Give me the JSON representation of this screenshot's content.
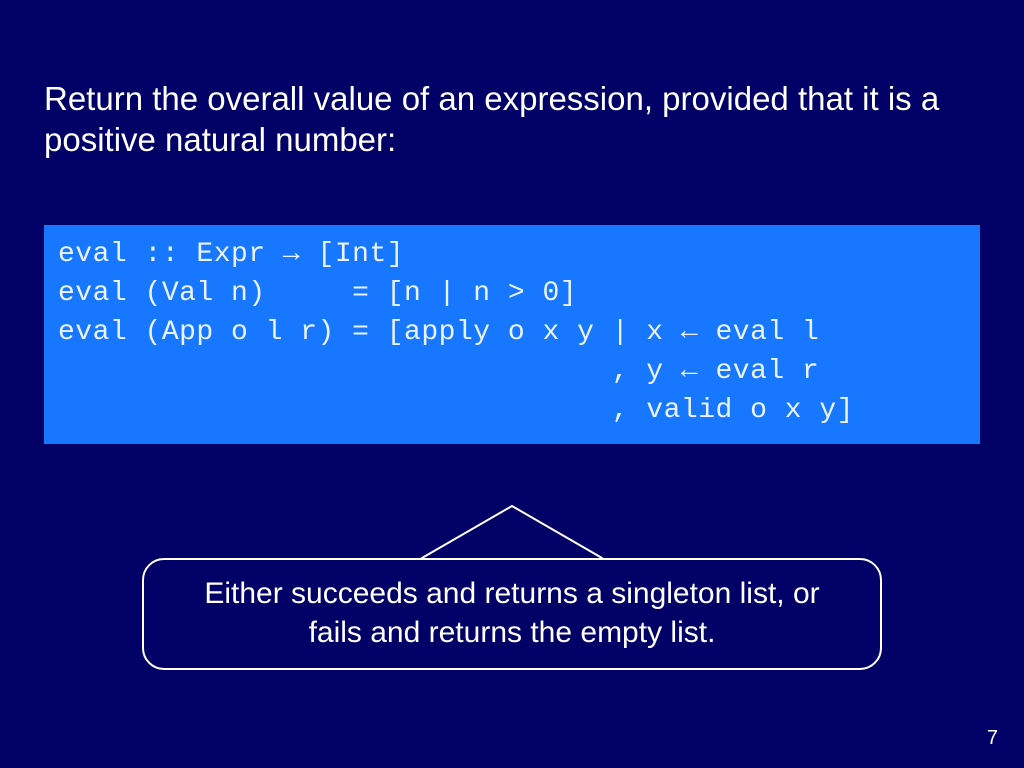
{
  "heading": "Return the overall value of an expression, provided that it is a positive natural number:",
  "code": "eval :: Expr → [Int]\neval (Val n)     = [n | n > 0]\neval (App o l r) = [apply o x y | x ← eval l\n                                , y ← eval r\n                                , valid o x y]",
  "callout": "Either succeeds and returns a singleton list, or fails and returns the empty list.",
  "page_number": "7"
}
